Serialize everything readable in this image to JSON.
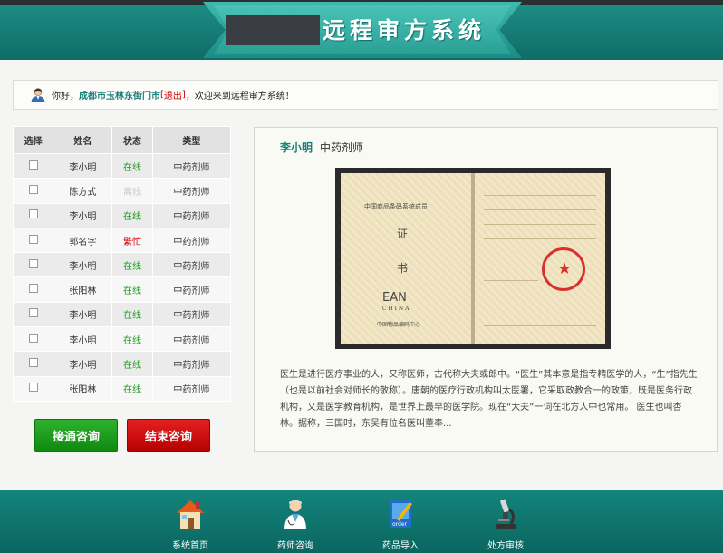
{
  "header": {
    "system_title": "远程审方系统"
  },
  "welcome": {
    "greeting": "你好，",
    "location": "成都市玉林东街门市",
    "logout_open": "[",
    "logout": "退出",
    "logout_close": "]",
    "message": "，欢迎来到远程审方系统！"
  },
  "table": {
    "headers": [
      "选择",
      "姓名",
      "状态",
      "类型"
    ],
    "rows": [
      {
        "name": "李小明",
        "status": "在线",
        "type": "中药剂师"
      },
      {
        "name": "陈方式",
        "status": "离线",
        "type": "中药剂师"
      },
      {
        "name": "李小明",
        "status": "在线",
        "type": "中药剂师"
      },
      {
        "name": "郭名字",
        "status": "繁忙",
        "type": "中药剂师"
      },
      {
        "name": "李小明",
        "status": "在线",
        "type": "中药剂师"
      },
      {
        "name": "张阳林",
        "status": "在线",
        "type": "中药剂师"
      },
      {
        "name": "李小明",
        "status": "在线",
        "type": "中药剂师"
      },
      {
        "name": "李小明",
        "status": "在线",
        "type": "中药剂师"
      },
      {
        "name": "李小明",
        "status": "在线",
        "type": "中药剂师"
      },
      {
        "name": "张阳林",
        "status": "在线",
        "type": "中药剂师"
      }
    ]
  },
  "buttons": {
    "connect": "接通咨询",
    "end": "结束咨询"
  },
  "detail": {
    "name": "李小明",
    "role": "中药剂师",
    "certificate": {
      "left_top": "中国商品条码系统成员",
      "left_char1": "证",
      "left_char2": "书",
      "left_brand": "EAN",
      "left_brand_sub": "C H I N A",
      "left_bottom": "中国物品编码中心"
    },
    "description": "医生是进行医疗事业的人，又称医师，古代称大夫或郎中。“医生”其本意是指专精医学的人，“生”指先生（也是以前社会对师长的敬称）。唐朝的医疗行政机构叫太医署，它采取政教合一的政策，既是医务行政机构，又是医学教育机构，是世界上最早的医学院。现在“大夫”一词在北方人中也常用。 医生也叫杏林。据称，三国时，东吴有位名医叫董奉..."
  },
  "footer": {
    "items": [
      {
        "label": "系统首页",
        "icon": "house-icon"
      },
      {
        "label": "药师咨询",
        "icon": "doctor-icon"
      },
      {
        "label": "药品导入",
        "icon": "order-book-icon"
      },
      {
        "label": "处方审核",
        "icon": "microscope-icon"
      }
    ]
  },
  "colors": {
    "accent": "#1a7f77",
    "online": "#1f9a1f",
    "offline": "#c8c8c8",
    "busy": "#d40000"
  }
}
